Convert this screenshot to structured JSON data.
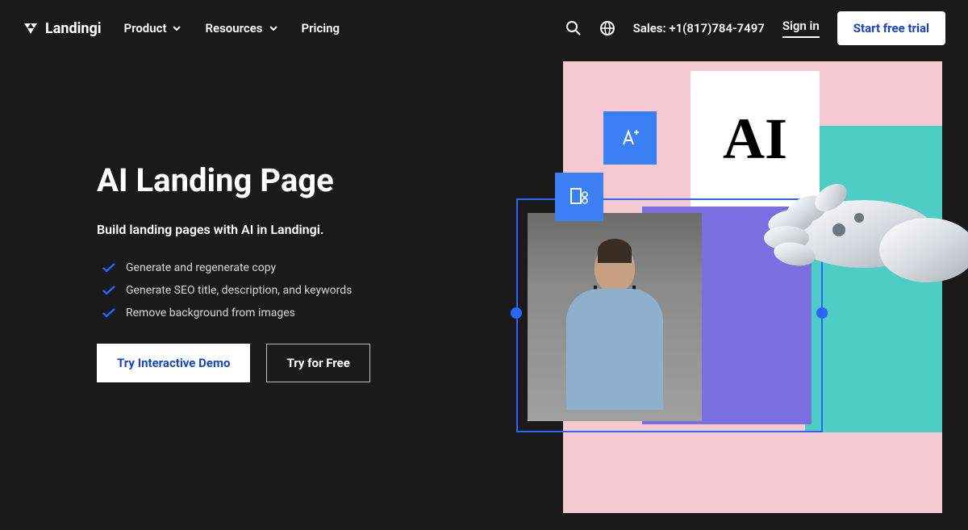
{
  "brand": {
    "name": "Landingi"
  },
  "nav": {
    "product": "Product",
    "resources": "Resources",
    "pricing": "Pricing"
  },
  "header": {
    "sales_prefix": "Sales: ",
    "sales_phone": "+1(817)784-7497",
    "signin": "Sign in",
    "cta": "Start free trial"
  },
  "hero": {
    "title": "AI Landing Page",
    "subtitle": "Build landing pages with AI in Landingi.",
    "features": [
      "Generate and regenerate copy",
      "Generate SEO title, description, and keywords",
      "Remove background from images"
    ],
    "btn_primary": "Try Interactive Demo",
    "btn_secondary": "Try for Free"
  },
  "illustration": {
    "card_text": "AI"
  }
}
